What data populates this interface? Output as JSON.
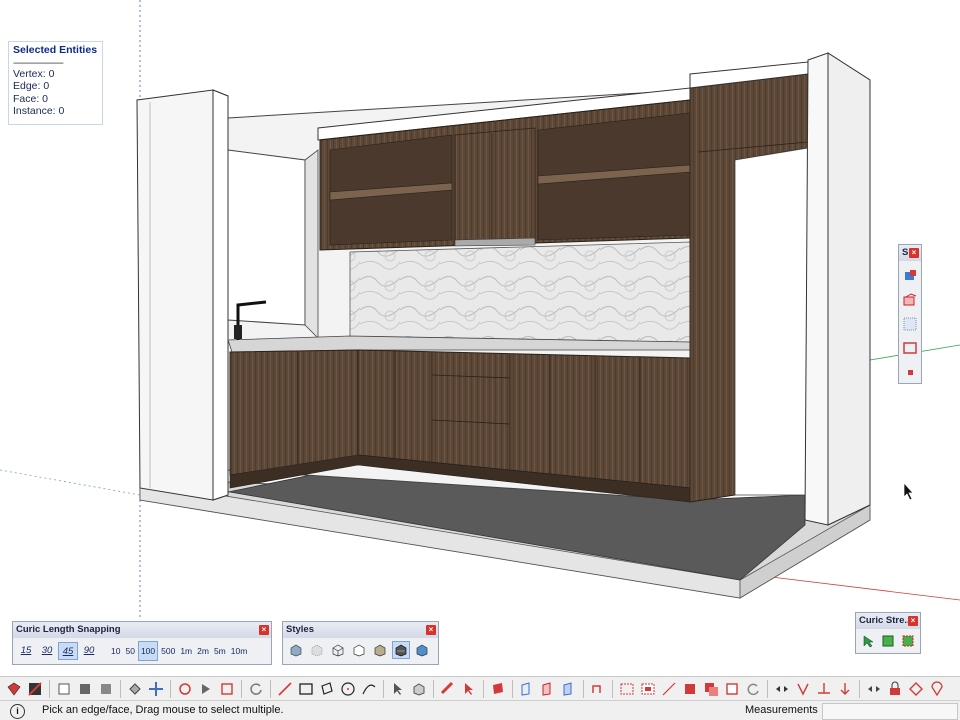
{
  "selected_entities": {
    "title": "Selected Entities",
    "separator": "--------------------",
    "vertex": "Vertex: 0",
    "edge": "Edge: 0",
    "face": "Face: 0",
    "instance": "Instance: 0"
  },
  "snapping_toolbar": {
    "title": "Curic Length Snapping",
    "close": "×",
    "angles": [
      "15",
      "30",
      "45",
      "90"
    ],
    "active_angle": "45",
    "lengths": [
      "10",
      "50",
      "100",
      "500",
      "1m",
      "2m",
      "5m",
      "10m"
    ],
    "active_length": "100"
  },
  "styles_toolbar": {
    "title": "Styles",
    "close": "×",
    "buttons": [
      "xray-icon",
      "back-edges-icon",
      "wireframe-icon",
      "hidden-line-icon",
      "shaded-icon",
      "shaded-textures-icon",
      "monochrome-icon"
    ],
    "active": "shaded-textures-icon"
  },
  "curic_stretch": {
    "title": "Curic Stre...",
    "close": "×"
  },
  "side_toolbar": {
    "title": "S.",
    "close": "×"
  },
  "status": {
    "message": "Pick an edge/face, Drag mouse to select multiple.",
    "measurements_label": "Measurements",
    "measurements_value": ""
  },
  "colors": {
    "wood": "#5e4a3a",
    "white_walls": "#f4f4f4",
    "floor": "#595959",
    "base": "#dcdcdc",
    "axis_red": "#d23a3a",
    "axis_green": "#3aa14a",
    "axis_blue": "#4a6ad8"
  }
}
